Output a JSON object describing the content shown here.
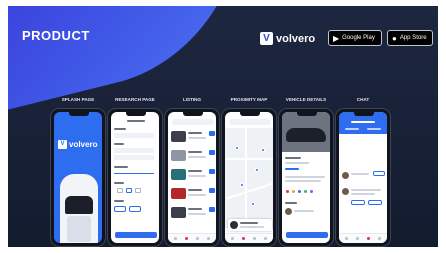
{
  "header": {
    "title": "PRODUCT",
    "brand_name": "volvero",
    "brand_mark": "V",
    "google_play_label": "Google Play",
    "app_store_label": "App Store"
  },
  "screens": [
    {
      "label": "SPLASH PAGE"
    },
    {
      "label": "RESEARCH PAGE"
    },
    {
      "label": "LISTING"
    },
    {
      "label": "PROXIMITY MAP"
    },
    {
      "label": "VEHICLE DETAILS"
    },
    {
      "label": "CHAT"
    }
  ],
  "splash": {
    "logo_text": "volvero",
    "logo_mark": "V"
  },
  "colors": {
    "accent": "#2f6df0",
    "background": "#1d2740",
    "blob": "#3f57e6",
    "active_tab": "#e0305f"
  },
  "icons": {
    "google_play": "play-triangle-icon",
    "app_store": "apple-icon"
  }
}
